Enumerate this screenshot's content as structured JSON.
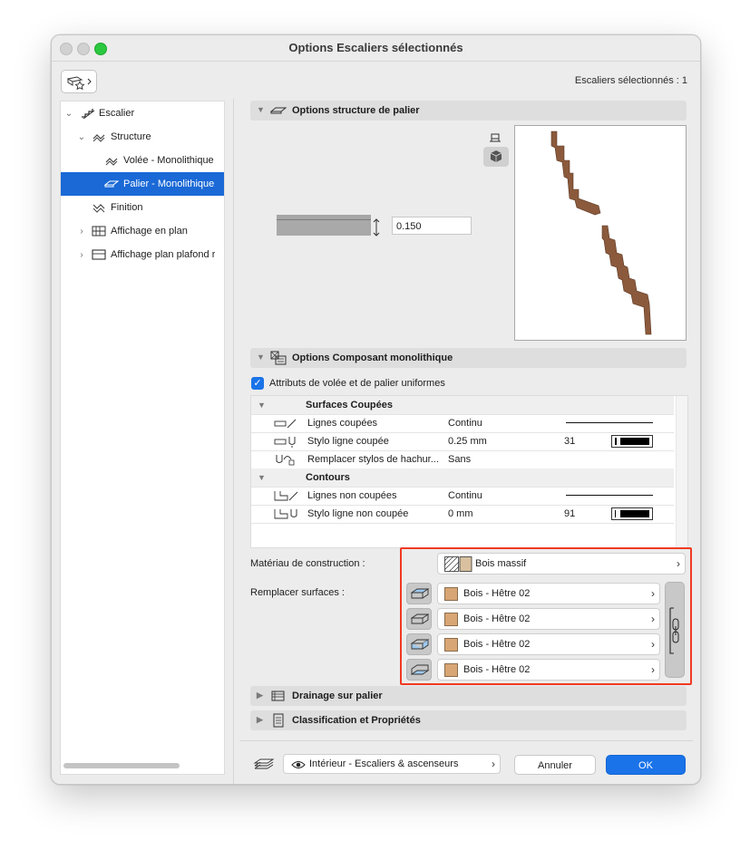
{
  "window": {
    "title": "Options Escaliers sélectionnés"
  },
  "header": {
    "selection_count": "Escaliers sélectionnés : 1"
  },
  "tree": {
    "items": [
      {
        "label": "Escalier"
      },
      {
        "label": "Structure"
      },
      {
        "label": "Volée - Monolithique"
      },
      {
        "label": "Palier - Monolithique"
      },
      {
        "label": "Finition"
      },
      {
        "label": "Affichage en plan"
      },
      {
        "label": "Affichage plan plafond r"
      }
    ]
  },
  "landing_section": {
    "title": "Options structure de palier",
    "thickness": "0.150"
  },
  "monolithic_section": {
    "title": "Options Composant monolithique",
    "uniform_checkbox_label": "Attributs de volée et de palier uniformes",
    "uniform_checked": true
  },
  "attr_table": {
    "group_cut": "Surfaces Coupées",
    "group_outline": "Contours",
    "rows": [
      {
        "name": "Lignes coupées",
        "value": "Continu",
        "num": ""
      },
      {
        "name": "Stylo ligne coupée",
        "value": "0.25 mm",
        "num": "31"
      },
      {
        "name": "Remplacer stylos de hachur...",
        "value": "Sans",
        "num": ""
      },
      {
        "name": "Lignes non coupées",
        "value": "Continu",
        "num": ""
      },
      {
        "name": "Stylo ligne non coupée",
        "value": "0 mm",
        "num": "91"
      }
    ]
  },
  "material": {
    "label": "Matériau de construction :",
    "value": "Bois massif"
  },
  "surfaces": {
    "label": "Remplacer surfaces :",
    "items": [
      "Bois - Hêtre 02",
      "Bois - Hêtre 02",
      "Bois - Hêtre 02",
      "Bois - Hêtre 02"
    ],
    "swatch_color": "#d8a674"
  },
  "collapsed_sections": [
    {
      "title": "Drainage sur palier"
    },
    {
      "title": "Classification et Propriétés"
    }
  ],
  "footer": {
    "layer_value": "Intérieur - Escaliers & ascenseurs",
    "cancel": "Annuler",
    "ok": "OK"
  },
  "colors": {
    "accent": "#1a73e8",
    "highlight": "#f03a22",
    "wood": "#8b5a3c"
  }
}
